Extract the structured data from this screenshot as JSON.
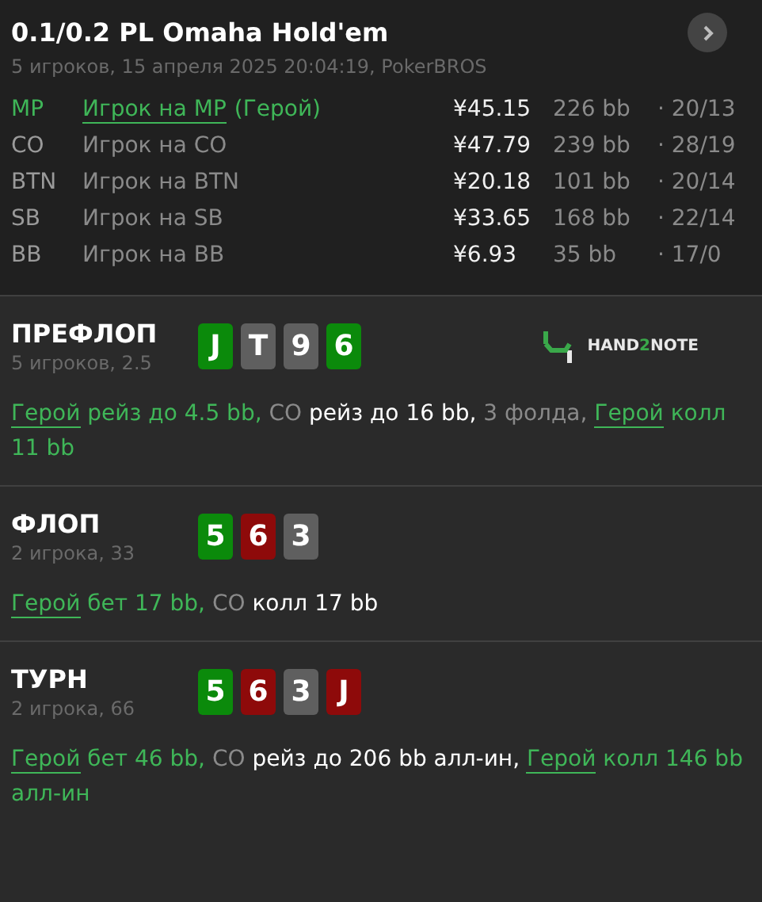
{
  "header": {
    "title": "0.1/0.2 PL Omaha Hold'em",
    "subtitle": "5 игроков, 15 апреля 2025 20:04:19, PokerBROS"
  },
  "players": [
    {
      "position": "MP",
      "name": "Игрок на MP",
      "hero": true,
      "hero_tag": "(Герой)",
      "stack": "¥45.15",
      "bb": "226 bb",
      "stats": "· 20/13"
    },
    {
      "position": "CO",
      "name": "Игрок на CO",
      "hero": false,
      "stack": "¥47.79",
      "bb": "239 bb",
      "stats": "· 28/19"
    },
    {
      "position": "BTN",
      "name": "Игрок на BTN",
      "hero": false,
      "stack": "¥20.18",
      "bb": "101 bb",
      "stats": "· 20/14"
    },
    {
      "position": "SB",
      "name": "Игрок на SB",
      "hero": false,
      "stack": "¥33.65",
      "bb": "168 bb",
      "stats": "· 22/14"
    },
    {
      "position": "BB",
      "name": "Игрок на BB",
      "hero": false,
      "stack": "¥6.93",
      "bb": "35 bb",
      "stats": "· 17/0"
    }
  ],
  "streets": [
    {
      "title": "ПРЕФЛОП",
      "info": "5 игроков, 2.5",
      "logo": [
        "HAND",
        "2",
        "NOTE"
      ],
      "cards": [
        {
          "rank": "J",
          "color": "#0b8a0b"
        },
        {
          "rank": "T",
          "color": "#5f5f5f"
        },
        {
          "rank": "9",
          "color": "#5f5f5f"
        },
        {
          "rank": "6",
          "color": "#0b8a0b"
        }
      ],
      "actions": [
        {
          "kind": "hero",
          "text": "Герой"
        },
        {
          "kind": "hero-action",
          "text": "рейз до 4.5 bb,"
        },
        {
          "kind": "player",
          "text": "CO"
        },
        {
          "kind": "action",
          "text": "рейз до 16 bb,"
        },
        {
          "kind": "player",
          "text": "3 фолда,"
        },
        {
          "kind": "hero",
          "text": "Герой"
        },
        {
          "kind": "hero-action",
          "text": "колл 11 bb"
        }
      ]
    },
    {
      "title": "ФЛОП",
      "info": "2 игрока, 33",
      "cards": [
        {
          "rank": "5",
          "color": "#0b8a0b"
        },
        {
          "rank": "6",
          "color": "#8e0a0a"
        },
        {
          "rank": "3",
          "color": "#5f5f5f"
        }
      ],
      "actions": [
        {
          "kind": "hero",
          "text": "Герой"
        },
        {
          "kind": "hero-action",
          "text": "бет 17 bb,"
        },
        {
          "kind": "player",
          "text": "CO"
        },
        {
          "kind": "action",
          "text": "колл 17 bb"
        }
      ]
    },
    {
      "title": "ТУРН",
      "info": "2 игрока, 66",
      "cards": [
        {
          "rank": "5",
          "color": "#0b8a0b"
        },
        {
          "rank": "6",
          "color": "#8e0a0a"
        },
        {
          "rank": "3",
          "color": "#5f5f5f"
        },
        {
          "rank": "J",
          "color": "#8e0a0a"
        }
      ],
      "actions": [
        {
          "kind": "hero",
          "text": "Герой"
        },
        {
          "kind": "hero-action",
          "text": "бет 46 bb,"
        },
        {
          "kind": "player",
          "text": "CO"
        },
        {
          "kind": "action",
          "text": "рейз до 206 bb алл-ин,"
        },
        {
          "kind": "hero",
          "text": "Герой"
        },
        {
          "kind": "hero-action",
          "text": "колл 146 bb алл-ин"
        }
      ]
    }
  ]
}
